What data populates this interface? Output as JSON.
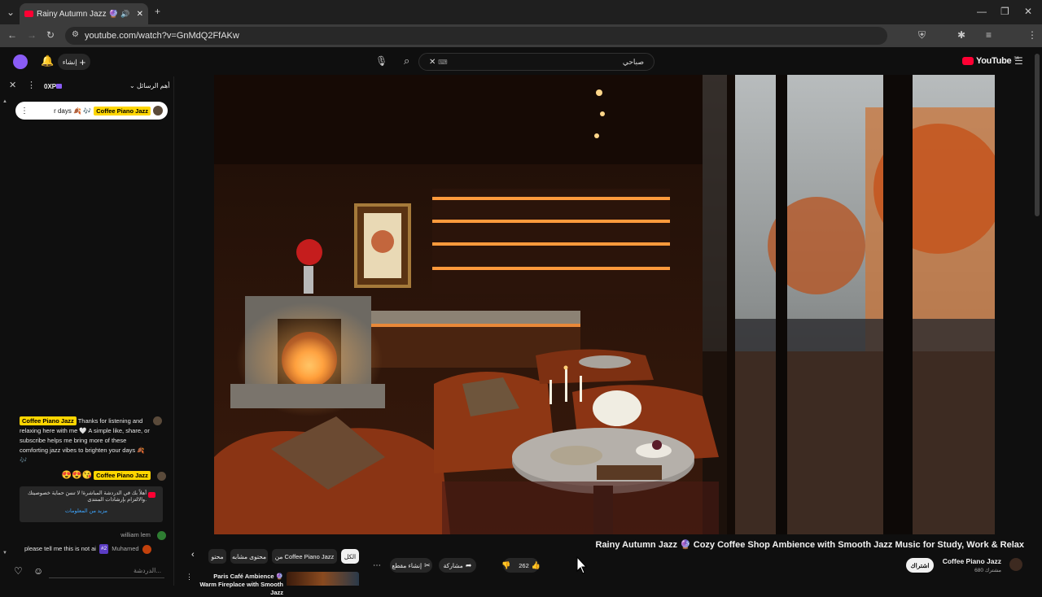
{
  "browser": {
    "tab_title": "Rainy Autumn Jazz 🔮 Co",
    "url": "youtube.com/watch?v=GnMdQ2FfAKw"
  },
  "header": {
    "logo_text": "YouTube",
    "logo_region": "SA",
    "create_label": "إنشاء",
    "search_query": "صباحي"
  },
  "chat": {
    "xp_label": "0XP",
    "mode_label": "أهم الرسائل",
    "pinned_text": "r days 🍂 🎶",
    "pinned_author": "Coffee Piano Jazz",
    "messages": [
      {
        "author": "Coffee Piano Jazz",
        "text": "Thanks for listening and relaxing here with me 🤍 A simple like, share, or subscribe helps me bring more of these comforting jazz vibes to brighten your days 🍂 🎶"
      },
      {
        "author": "Coffee Piano Jazz",
        "text": "😍😍😘"
      },
      {
        "author": "william lem",
        "text": ""
      },
      {
        "author": "Muhamed",
        "text": "please tell me this is not ai",
        "badge": "#2"
      }
    ],
    "notice_text": "أهلاً بك في الدردشة المباشرة! لا تنسَ حماية خصوصيتك والالتزام بإرشادات المنتدى.",
    "notice_link": "مزيد من المعلومات",
    "input_placeholder": "الدردشة..."
  },
  "video": {
    "title": "Rainy Autumn Jazz 🔮 Cozy Coffee Shop Ambience with Smooth Jazz Music for Study, Work & Relax",
    "channel": "Coffee Piano Jazz",
    "subscribers": "680 مشترك",
    "subscribe_label": "اشتراك",
    "like_count": "262",
    "share_label": "مشاركة",
    "clip_label": "إنشاء مقطع"
  },
  "filters": [
    "الكل",
    "من Coffee Piano Jazz",
    "محتوى مشابه",
    "محتو"
  ],
  "related": {
    "title": "Paris Café Ambience 🔮 Warm Fireplace with Smooth Jazz"
  },
  "colors": {
    "accent": "#ff0033",
    "badge": "#ffd600",
    "link": "#3ea6ff"
  }
}
